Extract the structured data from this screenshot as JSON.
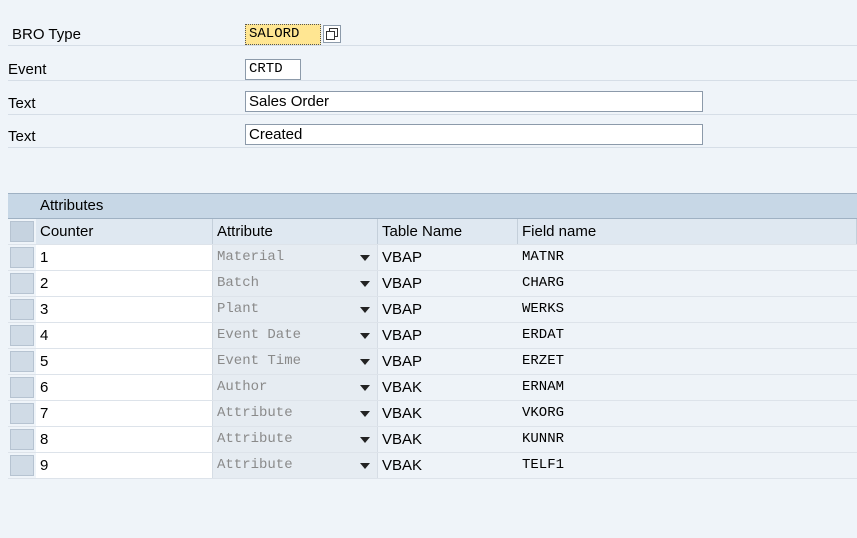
{
  "header": {
    "bro_type_label": "BRO Type",
    "bro_type_value": "SALORD",
    "event_label": "Event",
    "event_value": "CRTD",
    "text1_label": "Text",
    "text1_value": "Sales Order",
    "text2_label": "Text",
    "text2_value": "Created"
  },
  "grid": {
    "title": "Attributes",
    "columns": [
      "Counter",
      "Attribute",
      "Table Name",
      "Field name"
    ],
    "rows": [
      {
        "counter": "1",
        "attribute": "Material",
        "table": "VBAP",
        "field": "MATNR"
      },
      {
        "counter": "2",
        "attribute": "Batch",
        "table": "VBAP",
        "field": "CHARG"
      },
      {
        "counter": "3",
        "attribute": "Plant",
        "table": "VBAP",
        "field": "WERKS"
      },
      {
        "counter": "4",
        "attribute": "Event Date",
        "table": "VBAP",
        "field": "ERDAT"
      },
      {
        "counter": "5",
        "attribute": "Event Time",
        "table": "VBAP",
        "field": "ERZET"
      },
      {
        "counter": "6",
        "attribute": "Author",
        "table": "VBAK",
        "field": "ERNAM"
      },
      {
        "counter": "7",
        "attribute": "Attribute",
        "table": "VBAK",
        "field": "VKORG"
      },
      {
        "counter": "8",
        "attribute": "Attribute",
        "table": "VBAK",
        "field": "KUNNR"
      },
      {
        "counter": "9",
        "attribute": "Attribute",
        "table": "VBAK",
        "field": "TELF1"
      }
    ]
  },
  "icons": {
    "value_help": "f4-value-help-icon",
    "dropdown": "dropdown-arrow-icon"
  }
}
